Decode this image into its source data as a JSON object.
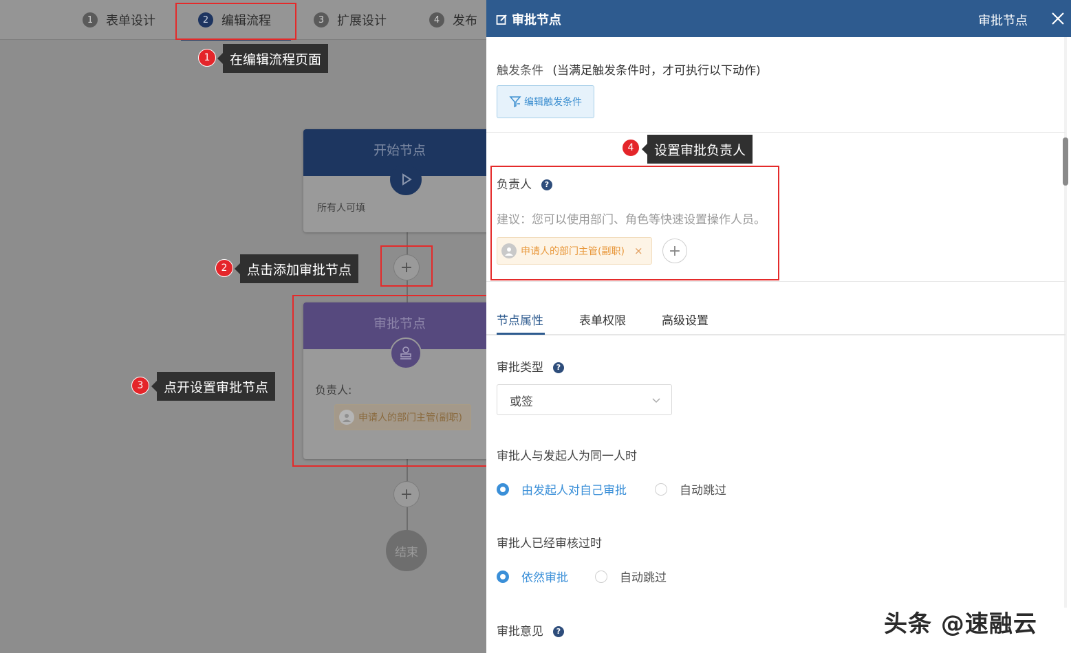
{
  "steps": [
    {
      "num": "1",
      "label": "表单设计"
    },
    {
      "num": "2",
      "label": "编辑流程"
    },
    {
      "num": "3",
      "label": "扩展设计"
    },
    {
      "num": "4",
      "label": "发布"
    }
  ],
  "flow": {
    "start_node": {
      "title": "开始节点",
      "desc": "所有人可填"
    },
    "approve_node": {
      "title": "审批节点",
      "owner_label": "负责人:",
      "owner_tag": "申请人的部门主管(副职)"
    },
    "add_symbol": "+",
    "end_node": "结束"
  },
  "annotations": {
    "a1": {
      "num": "1",
      "text": "在编辑流程页面"
    },
    "a2": {
      "num": "2",
      "text": "点击添加审批节点"
    },
    "a3": {
      "num": "3",
      "text": "点开设置审批节点"
    },
    "a4": {
      "num": "4",
      "text": "设置审批负责人"
    }
  },
  "panel": {
    "title": "审批节点",
    "right_title": "审批节点",
    "trigger_label": "触发条件",
    "trigger_hint": "(当满足触发条件时，才可执行以下动作)",
    "edit_trigger_btn": "编辑触发条件",
    "owner_label": "负责人",
    "help": "?",
    "owner_suggest": "建议：您可以使用部门、角色等快速设置操作人员。",
    "owner_tag": "申请人的部门主管(副职)",
    "tag_close": "×",
    "add_symbol": "+",
    "tabs": [
      "节点属性",
      "表单权限",
      "高级设置"
    ],
    "approval_type_label": "审批类型",
    "approval_type_value": "或签",
    "same_person_label": "审批人与发起人为同一人时",
    "same_person_options": [
      "由发起人对自己审批",
      "自动跳过"
    ],
    "already_reviewed_label": "审批人已经审核过时",
    "already_reviewed_options": [
      "依然审批",
      "自动跳过"
    ],
    "opinion_label": "审批意见"
  },
  "watermark": "头条 @速融云",
  "colors": {
    "header": "#2e5b8f",
    "accent": "#3a8fd8",
    "annotation": "#e4252a",
    "tag": "#e8973a"
  }
}
